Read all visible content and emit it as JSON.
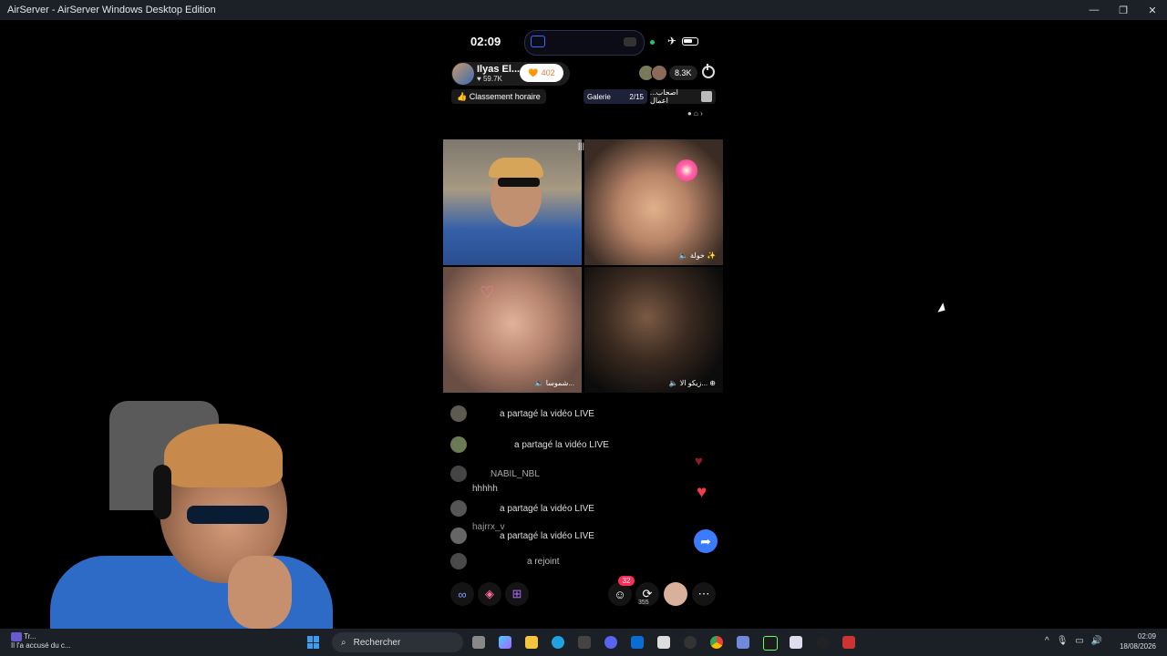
{
  "window": {
    "title": "AirServer - AirServer Windows Desktop Edition",
    "minimize": "—",
    "maximize": "❐",
    "close": "✕"
  },
  "phone": {
    "status": {
      "time": "02:09"
    },
    "host": {
      "name": "Ilyas El...",
      "followers": "59.7K",
      "likes": "402"
    },
    "viewers": {
      "count": "8.3K"
    },
    "ranking": {
      "label": "Classement horaire"
    },
    "gallery": {
      "label": "Galerie",
      "count": "2/15"
    },
    "group": {
      "label": "...اصحاب اعمال"
    },
    "tiles": [
      {
        "label": ""
      },
      {
        "label": "خولة ✨"
      },
      {
        "label": "شموسا..."
      },
      {
        "label": "زيكو الا..."
      }
    ],
    "comments": [
      {
        "text": "a partagé la vidéo LIVE"
      },
      {
        "text": "a partagé la vidéo LIVE"
      },
      {
        "text": "NABIL_NBL"
      },
      {
        "text": "hhhhh"
      },
      {
        "text": "a partagé la vidéo LIVE"
      },
      {
        "text": "hajrrx_v"
      },
      {
        "text": "a partagé la vidéo LIVE"
      },
      {
        "text": "a rejoint"
      }
    ],
    "badge_count": "32",
    "share_count": "355"
  },
  "taskbar": {
    "notification_title": "Tr...",
    "notification_text": "Il l'a accusé du c...",
    "search_placeholder": "Rechercher",
    "time": "02:09",
    "date": "18/08/2026"
  }
}
